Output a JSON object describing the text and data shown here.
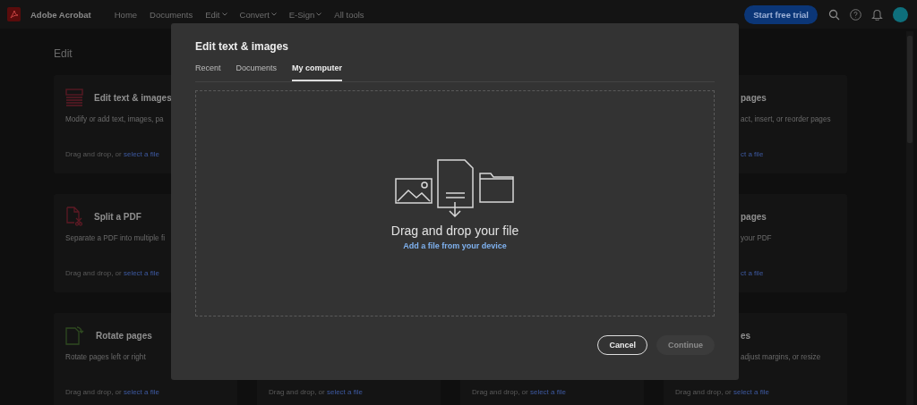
{
  "header": {
    "app_name": "Adobe Acrobat",
    "nav": [
      {
        "label": "Home",
        "dropdown": false
      },
      {
        "label": "Documents",
        "dropdown": false
      },
      {
        "label": "Edit",
        "dropdown": true
      },
      {
        "label": "Convert",
        "dropdown": true
      },
      {
        "label": "E-Sign",
        "dropdown": true
      },
      {
        "label": "All tools",
        "dropdown": false
      }
    ],
    "cta": "Start free trial"
  },
  "page": {
    "heading": "Edit",
    "rows": [
      {
        "left": {
          "kind": "edit",
          "title": "Edit text & images",
          "description": "Modify or add text, images, pa",
          "footer": "Drag and drop, or ",
          "link": "select a file"
        },
        "right": {
          "title": "pages",
          "description": "act, insert, or reorder pages",
          "link": "ct a file"
        }
      },
      {
        "left": {
          "kind": "split",
          "title": "Split a PDF",
          "description": "Separate a PDF into multiple fi",
          "footer": "Drag and drop, or ",
          "link": "select a file"
        },
        "right": {
          "title": "pages",
          "description": "your PDF",
          "link": "ct a file"
        }
      },
      {
        "left": {
          "kind": "rotate",
          "title": "Rotate pages",
          "description": "Rotate pages left or right",
          "footer": "Drag and drop, or ",
          "link": "select a file"
        },
        "middle": [
          {
            "footer": "Drag and drop, or ",
            "link": "select a file"
          },
          {
            "footer": "Drag and drop, or ",
            "link": "select a file"
          }
        ],
        "right": {
          "title": "es",
          "description": "adjust margins, or resize",
          "footer": "Drag and drop, or ",
          "link": "select a file"
        }
      }
    ]
  },
  "dialog": {
    "title": "Edit text & images",
    "tabs": [
      {
        "label": "Recent",
        "selected": false
      },
      {
        "label": "Documents",
        "selected": false
      },
      {
        "label": "My computer",
        "selected": true
      }
    ],
    "drop_text": "Drag and drop your file",
    "drop_link": "Add a file from your device",
    "buttons": [
      {
        "label": "Cancel",
        "disabled": false
      },
      {
        "label": "Continue",
        "disabled": true
      }
    ]
  }
}
